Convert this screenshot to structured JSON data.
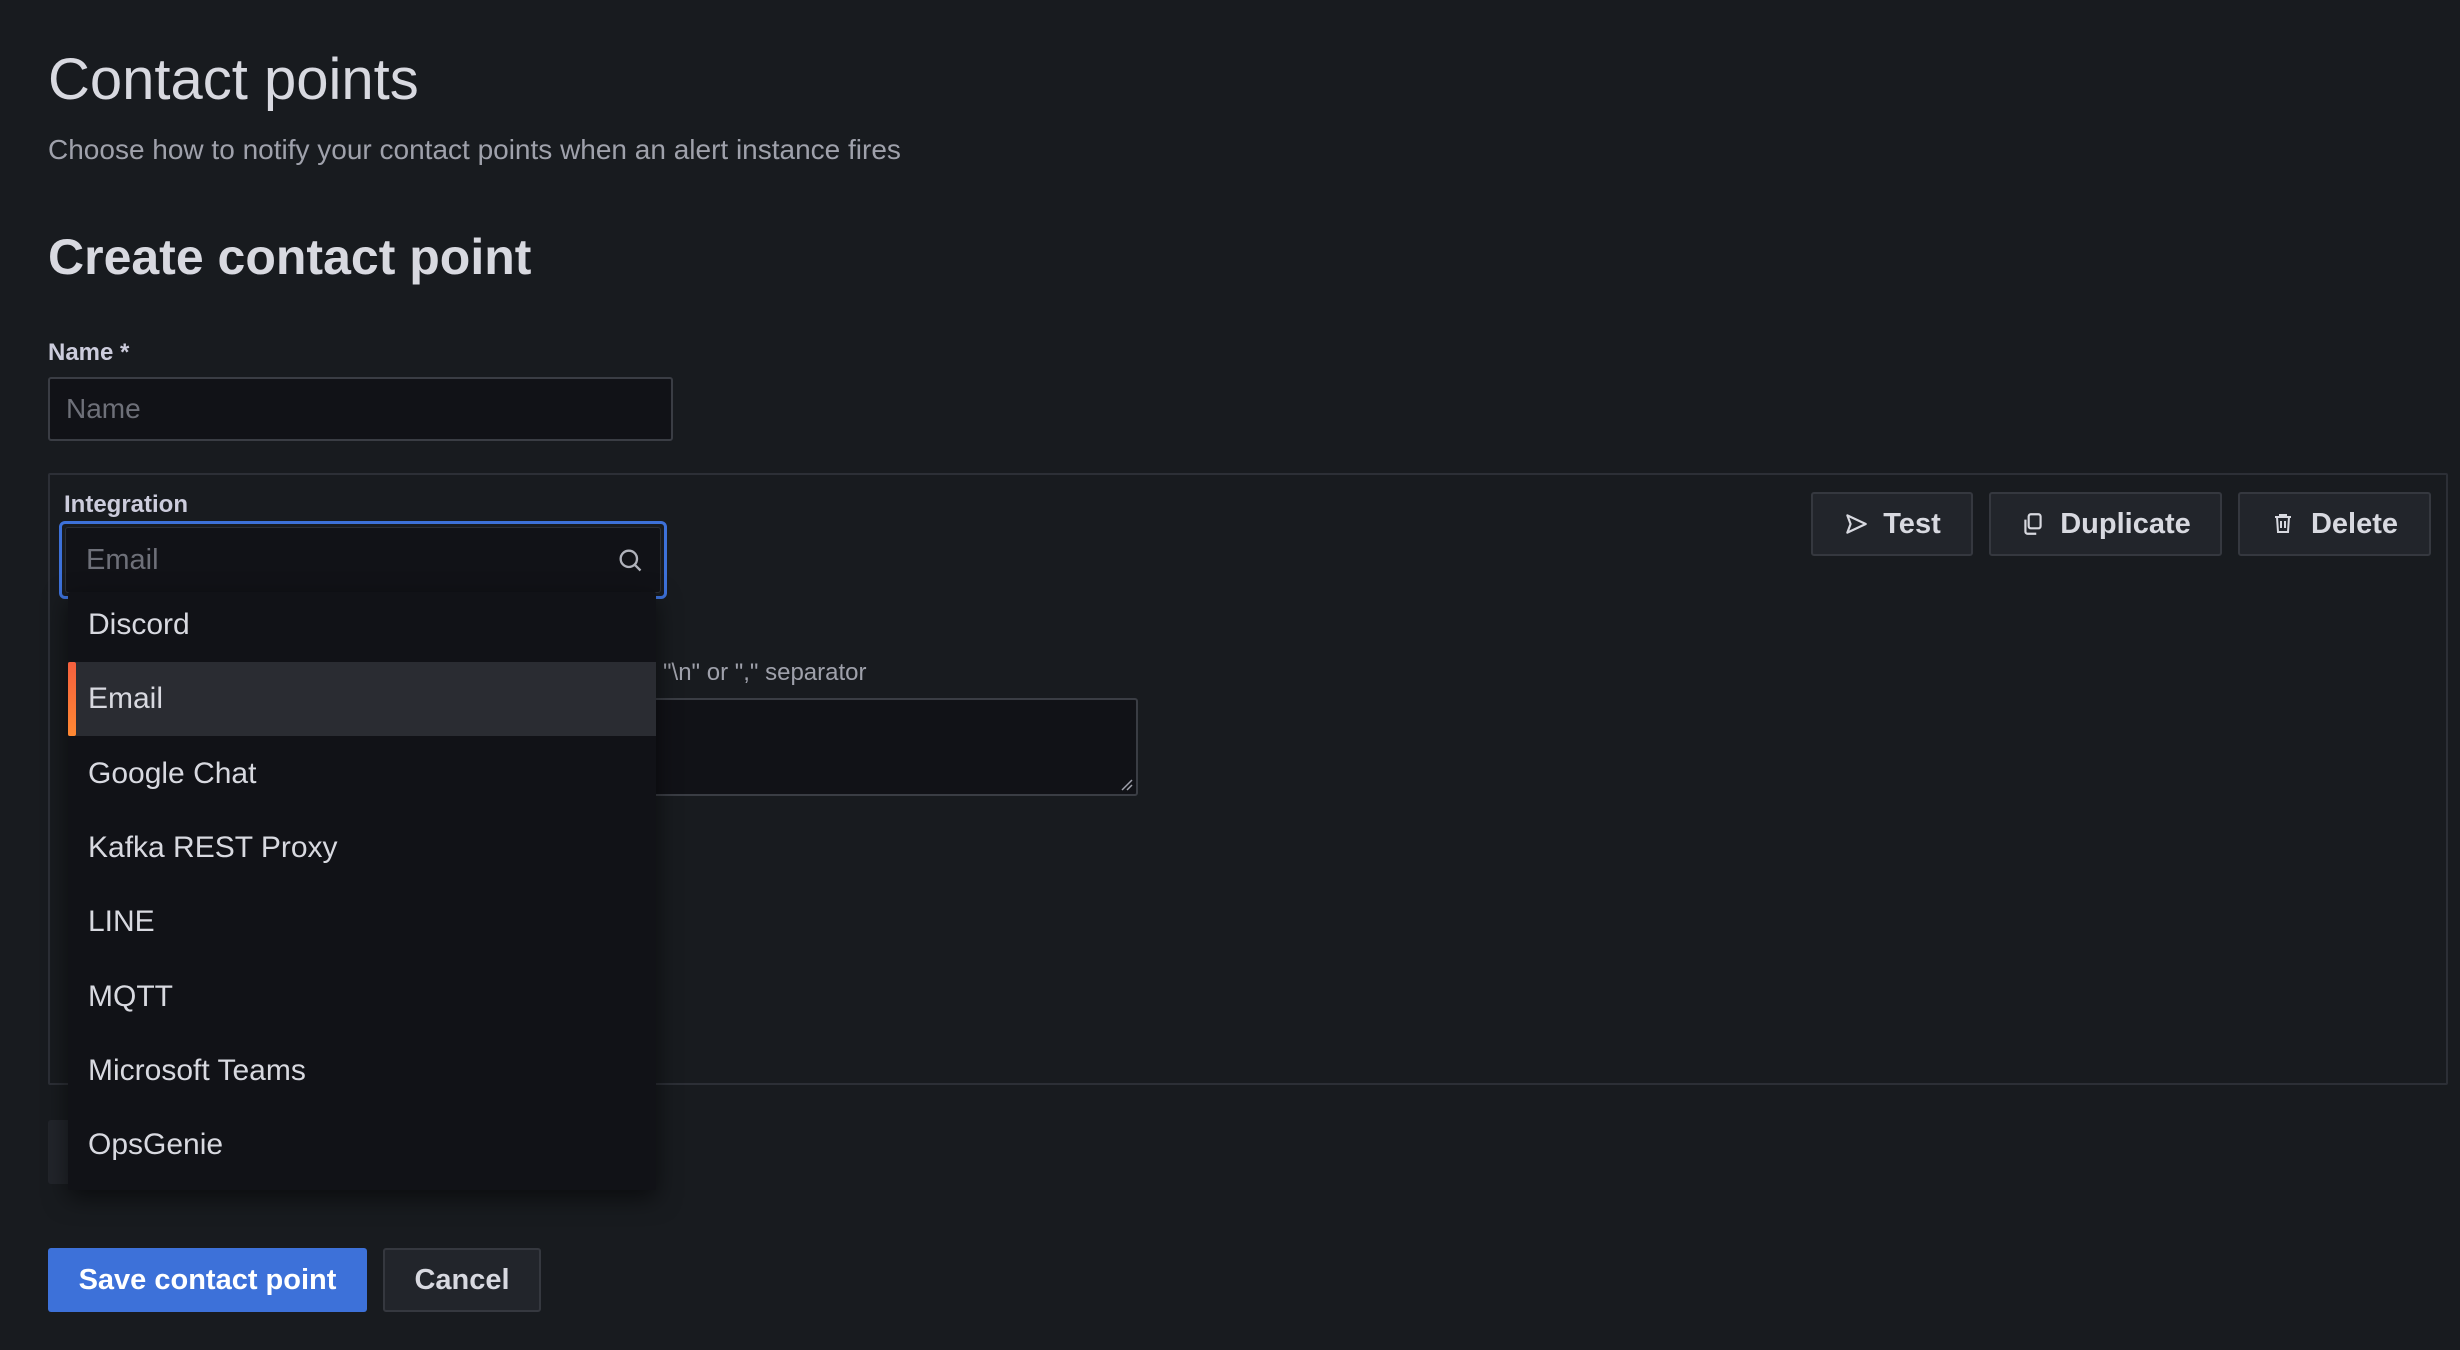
{
  "header": {
    "title": "Contact points",
    "subtitle": "Choose how to notify your contact points when an alert instance fires"
  },
  "form": {
    "section_title": "Create contact point",
    "name_label": "Name *",
    "name_placeholder": "Name",
    "integration": {
      "label": "Integration",
      "search_placeholder": "Email",
      "selected": "Email",
      "options": [
        "Discord",
        "Email",
        "Google Chat",
        "Kafka REST Proxy",
        "LINE",
        "MQTT",
        "Microsoft Teams",
        "OpsGenie"
      ],
      "actions": {
        "test_label": "Test",
        "duplicate_label": "Duplicate",
        "delete_label": "Delete"
      },
      "addresses_hint_fragment": "\"\\n\" or \",\" separator"
    },
    "save_label": "Save contact point",
    "cancel_label": "Cancel"
  },
  "icons": {
    "test": "send-icon",
    "duplicate": "copy-icon",
    "delete": "trash-icon",
    "search": "search-icon"
  },
  "colors": {
    "background": "#181b1f",
    "primary": "#3d71d9",
    "selected_accent": "#f55f3e"
  }
}
